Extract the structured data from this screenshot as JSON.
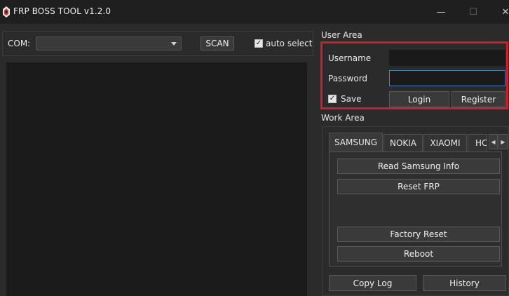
{
  "window": {
    "title": "FRP BOSS TOOL v1.2.0",
    "minimize_glyph": "—",
    "maximize_glyph": "☐",
    "close_glyph": "✕"
  },
  "toolbar": {
    "com_label": "COM:",
    "com_value": "",
    "scan_label": "SCAN",
    "auto_select_checked": true,
    "auto_select_label": "auto select",
    "check_glyph": "✓"
  },
  "user_area": {
    "title": "User Area",
    "username_label": "Username",
    "username_value": "",
    "password_label": "Password",
    "password_value": "",
    "save_checked": true,
    "save_label": "Save",
    "login_label": "Login",
    "register_label": "Register",
    "highlight_color": "#cf1f24"
  },
  "work_area": {
    "title": "Work Area",
    "tabs": [
      {
        "label": "SAMSUNG",
        "active": true
      },
      {
        "label": "NOKIA",
        "active": false
      },
      {
        "label": "XIAOMI",
        "active": false
      },
      {
        "label": "HC",
        "active": false
      }
    ],
    "tab_scroll_left": "◀",
    "tab_scroll_right": "▶",
    "actions": {
      "read_info": "Read Samsung Info",
      "reset_frp": "Reset FRP",
      "factory_reset": "Factory Reset",
      "reboot": "Reboot"
    },
    "copy_log_label": "Copy Log",
    "history_label": "History"
  },
  "colors": {
    "background": "#2b2b2b",
    "titlebar": "#1f1f1f",
    "log_panel": "#1b1b1b",
    "input_focus_border": "#4a7fc3"
  }
}
